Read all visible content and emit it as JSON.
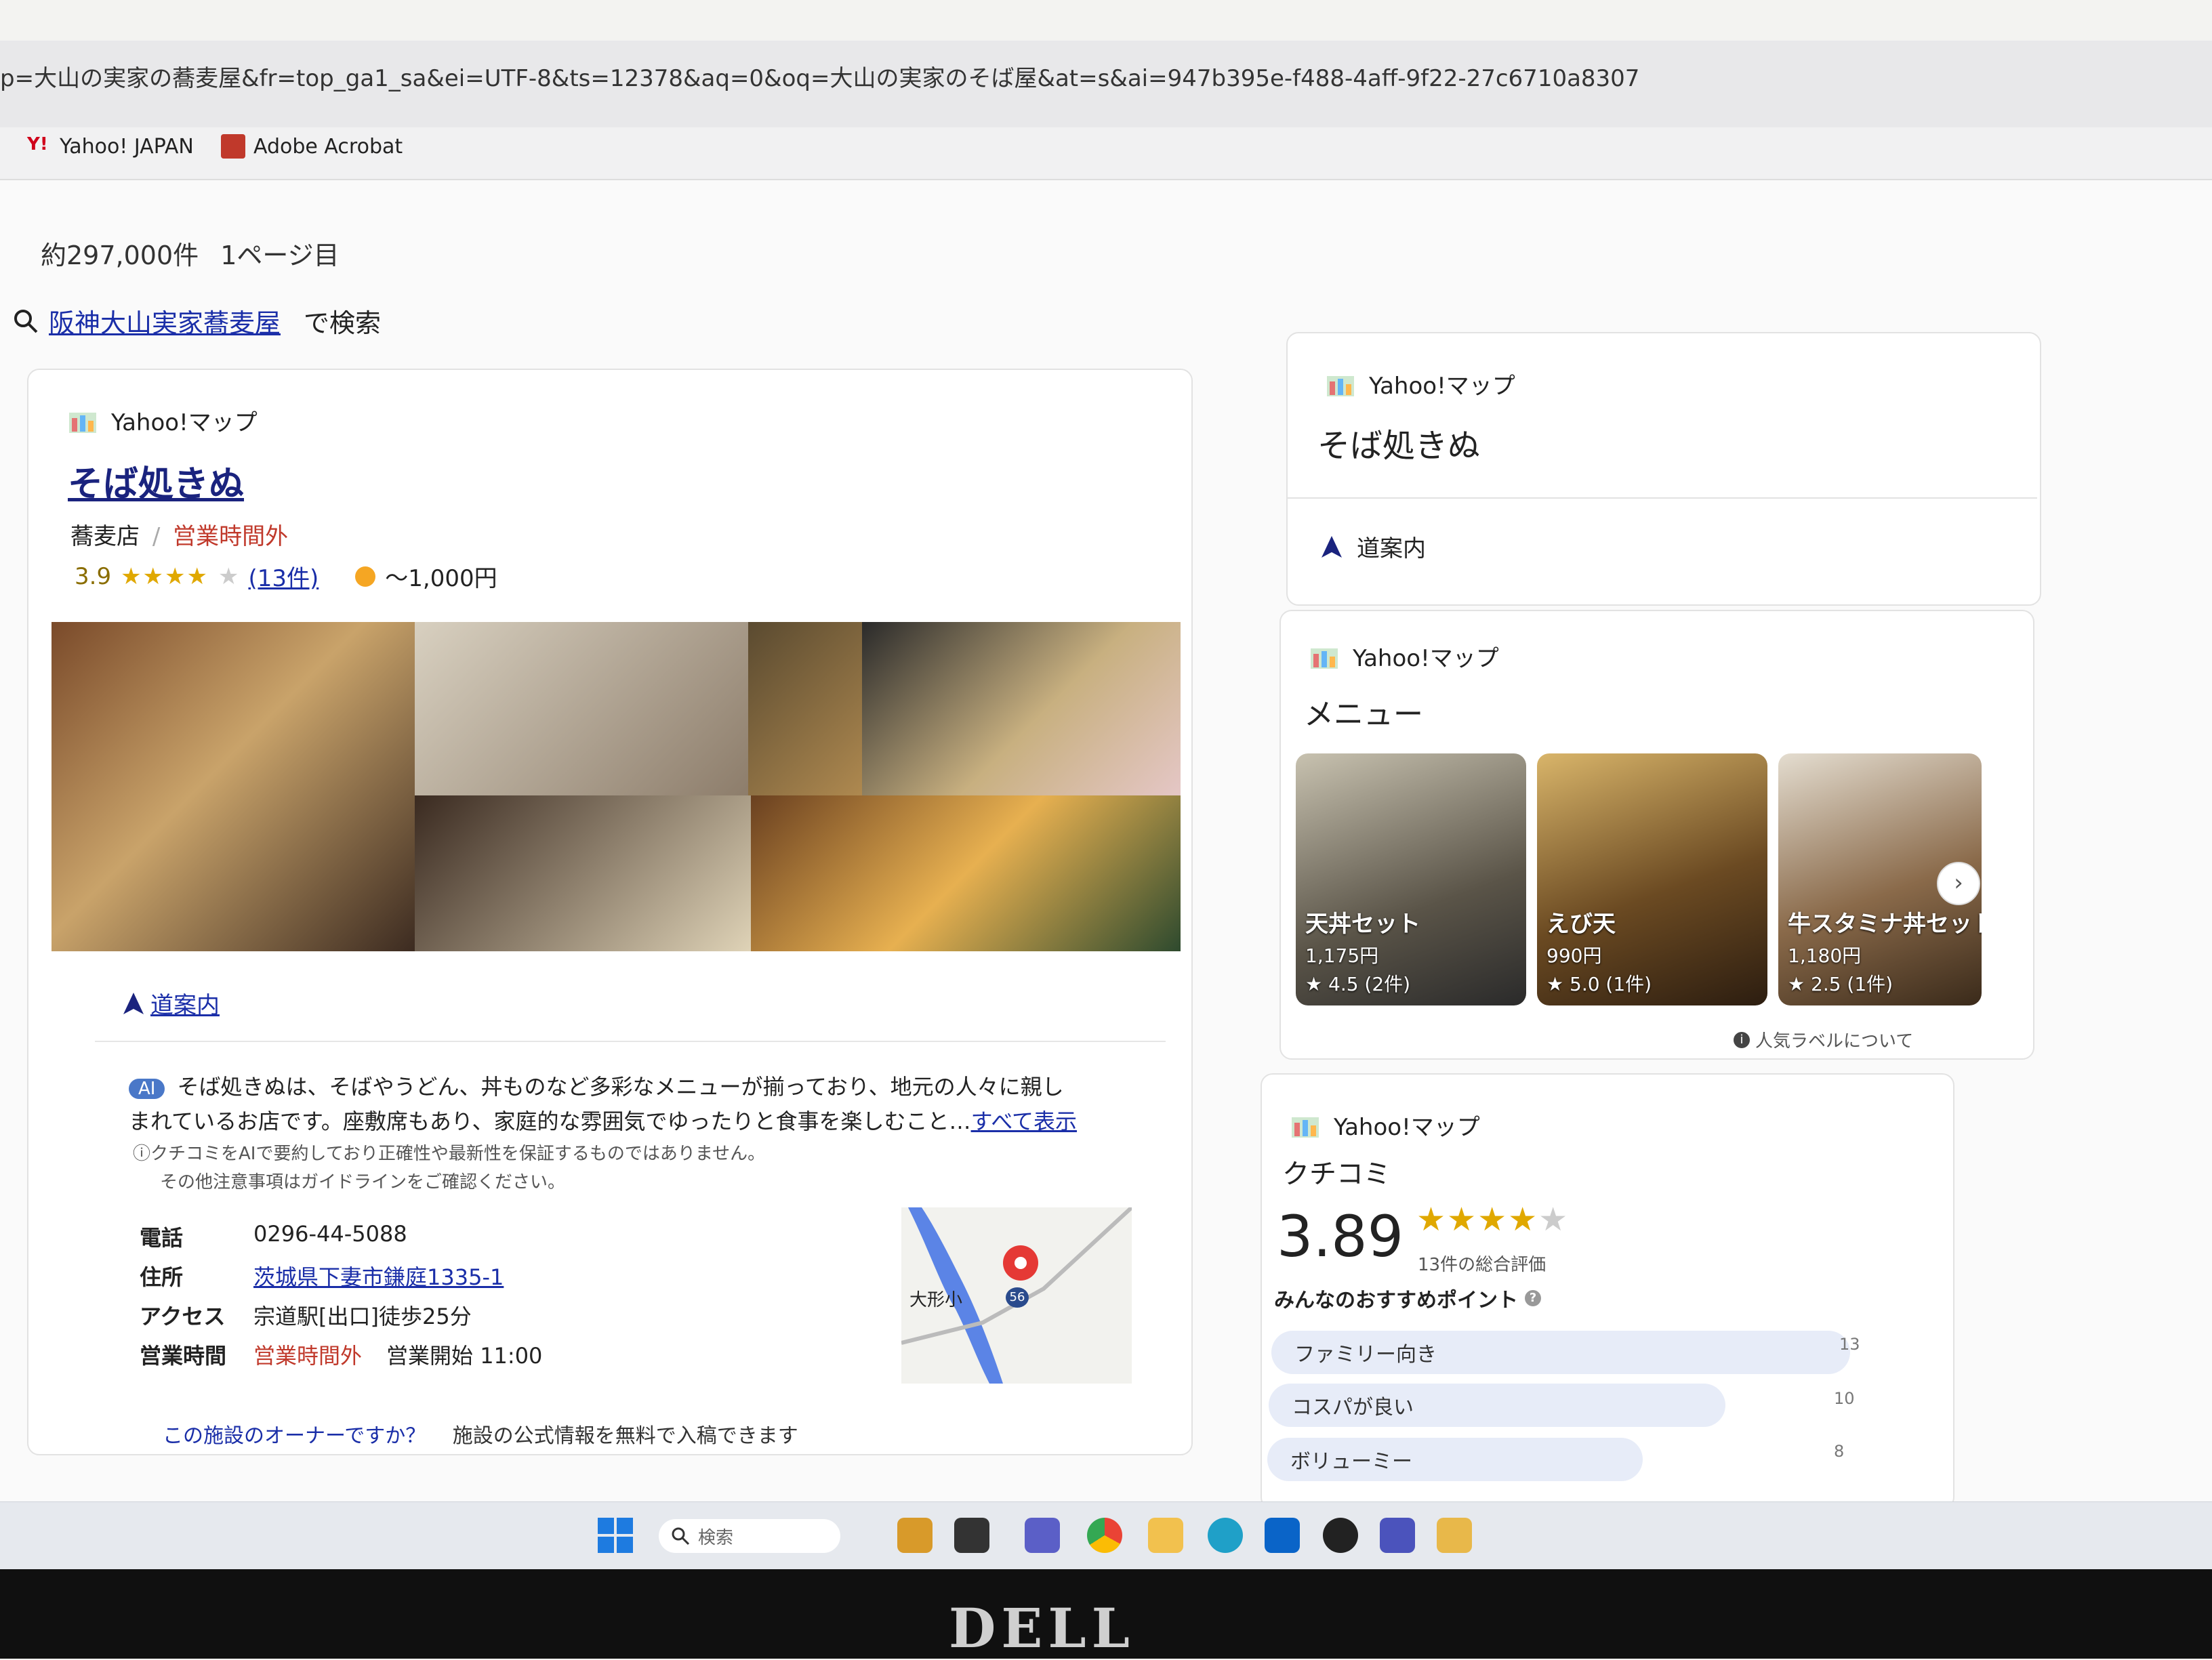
{
  "browser": {
    "url": "p=大山の実家の蕎麦屋&fr=top_ga1_sa&ei=UTF-8&ts=12378&aq=0&oq=大山の実家のそば屋&at=s&ai=947b395e-f488-4aff-9f22-27c6710a8307",
    "bookmarks": [
      {
        "label": "Yahoo! JAPAN",
        "icon": "yahoo-icon"
      },
      {
        "label": "Adobe Acrobat",
        "icon": "acrobat-icon"
      }
    ]
  },
  "results": {
    "count": "約297,000件",
    "page": "1ページ目",
    "suggest_query": "阪神大山実家蕎麦屋",
    "suggest_suffix": "で検索"
  },
  "main_card": {
    "source": "Yahoo!マップ",
    "title": "そば処きぬ",
    "category": "蕎麦店",
    "separator": "/",
    "status": "営業時間外",
    "rating": "3.9",
    "stars": "★★★★",
    "star_empty": "★",
    "review_count": "(13件)",
    "price": "～1,000円",
    "route_label": "道案内",
    "ai_badge": "AI",
    "ai_summary_1": "そば処きぬは、そばやうどん、丼ものなど多彩なメニューが揃っており、地元の人々に親し",
    "ai_summary_2": "まれているお店です。座敷席もあり、家庭的な雰囲気でゆったりと食事を楽しむこと…",
    "show_all": "すべて表示",
    "ai_note_1": "クチコミをAIで要約しており正確性や最新性を保証するものではありません。",
    "ai_note_2": "その他注意事項はガイドラインをご確認ください。",
    "info": {
      "phone_label": "電話",
      "phone": "0296-44-5088",
      "address_label": "住所",
      "address": "茨城県下妻市鎌庭1335-1",
      "access_label": "アクセス",
      "access": "宗道駅[出口]徒歩25分",
      "hours_label": "営業時間",
      "hours_status": "営業時間外",
      "hours_open": "営業開始 11:00"
    },
    "map": {
      "label": "大形小",
      "route": "56"
    },
    "owner_q": "この施設のオーナーですか？",
    "owner_text": "施設の公式情報を無料で入稿できます"
  },
  "side_top": {
    "source": "Yahoo!マップ",
    "title": "そば処きぬ",
    "route_label": "道案内"
  },
  "side_menu": {
    "source": "Yahoo!マップ",
    "title": "メニュー",
    "items": [
      {
        "name": "天丼セット",
        "price": "1,175円",
        "rating": "★ 4.5 (2件)"
      },
      {
        "name": "えび天",
        "price": "990円",
        "rating": "★ 5.0 (1件)"
      },
      {
        "name": "牛スタミナ丼セット",
        "price": "1,180円",
        "rating": "★ 2.5 (1件)"
      }
    ],
    "note": "人気ラベルについて"
  },
  "side_review": {
    "source": "Yahoo!マップ",
    "title": "クチコミ",
    "score": "3.89",
    "stars": "★★★★",
    "star_empty": "★",
    "total": "13件の総合評価",
    "points_title": "みんなのおすすめポイント",
    "points": [
      {
        "label": "ファミリー向き",
        "count": "13"
      },
      {
        "label": "コスパが良い",
        "count": "10"
      },
      {
        "label": "ボリューミー",
        "count": "8"
      }
    ]
  },
  "taskbar": {
    "search_placeholder": "検索"
  },
  "monitor": {
    "brand": "DELL"
  },
  "colors": {
    "accent_red": "#c0392b",
    "link_blue": "#1a2ea8",
    "star_gold": "#e0a800"
  }
}
